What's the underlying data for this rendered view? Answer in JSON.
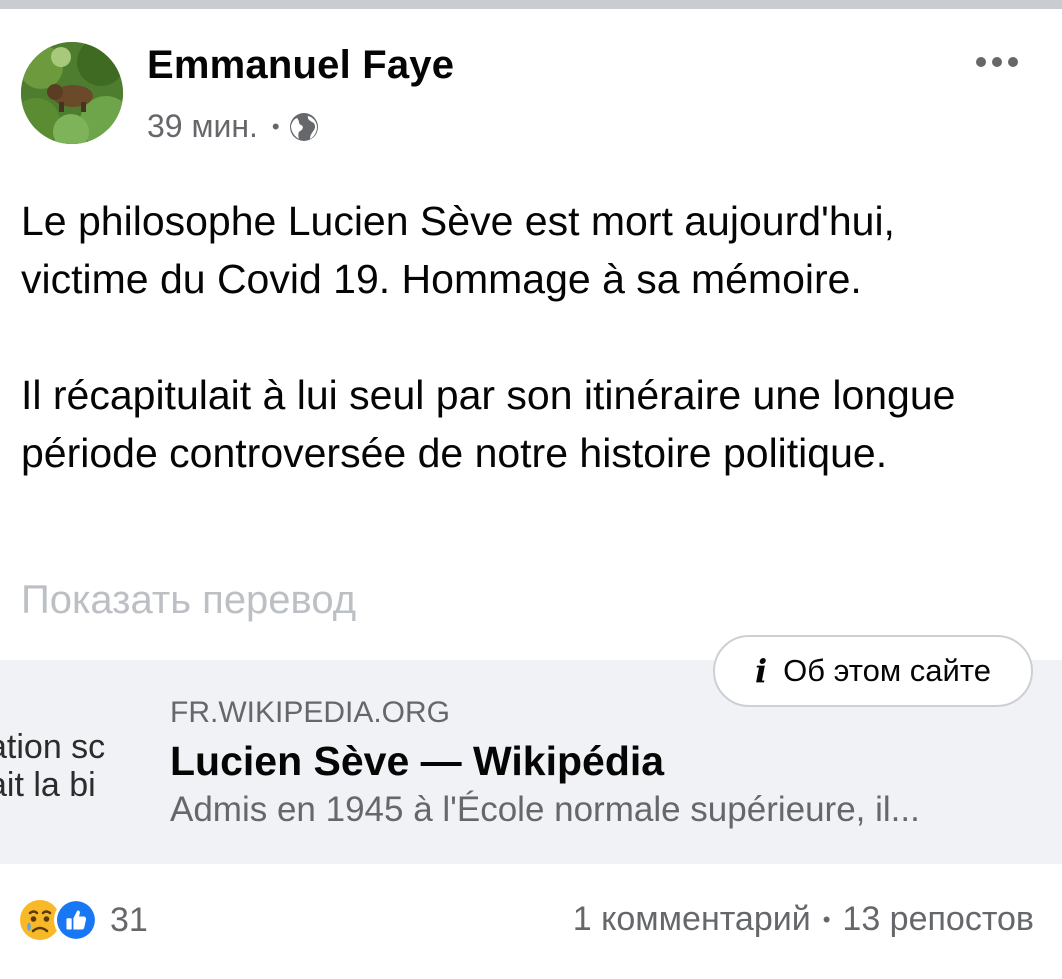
{
  "post": {
    "author": "Emmanuel Faye",
    "time": "39 мин.",
    "meta_separator": "•",
    "paragraphs": [
      "Le philosophe Lucien Sève est mort aujourd'hui, victime du Covid 19. Hommage à sa mémoire.",
      "Il récapitulait à lui seul par son itinéraire une longue période controversée de notre histoire politique."
    ],
    "translate_label": "Показать перевод"
  },
  "link_card": {
    "about_icon": "i",
    "about_label": "Об этом сайте",
    "thumb_line1": "ation sc",
    "thumb_line2": "ait la bi",
    "domain": "FR.WIKIPEDIA.ORG",
    "title": "Lucien Sève — Wikipédia",
    "description": "Admis en 1945 à l'École normale supérieure, il..."
  },
  "footer": {
    "reaction_icons": [
      "sad-reaction-icon",
      "like-reaction-icon"
    ],
    "reaction_count": "31",
    "comments": "1 комментарий",
    "separator": "•",
    "shares": "13 репостов"
  },
  "colors": {
    "text": "#050505",
    "secondary": "#65676b",
    "muted": "#bcc0c4",
    "card_bg": "#f0f2f5",
    "like_blue": "#1877f2",
    "sad_yellow": "#f7b928"
  }
}
